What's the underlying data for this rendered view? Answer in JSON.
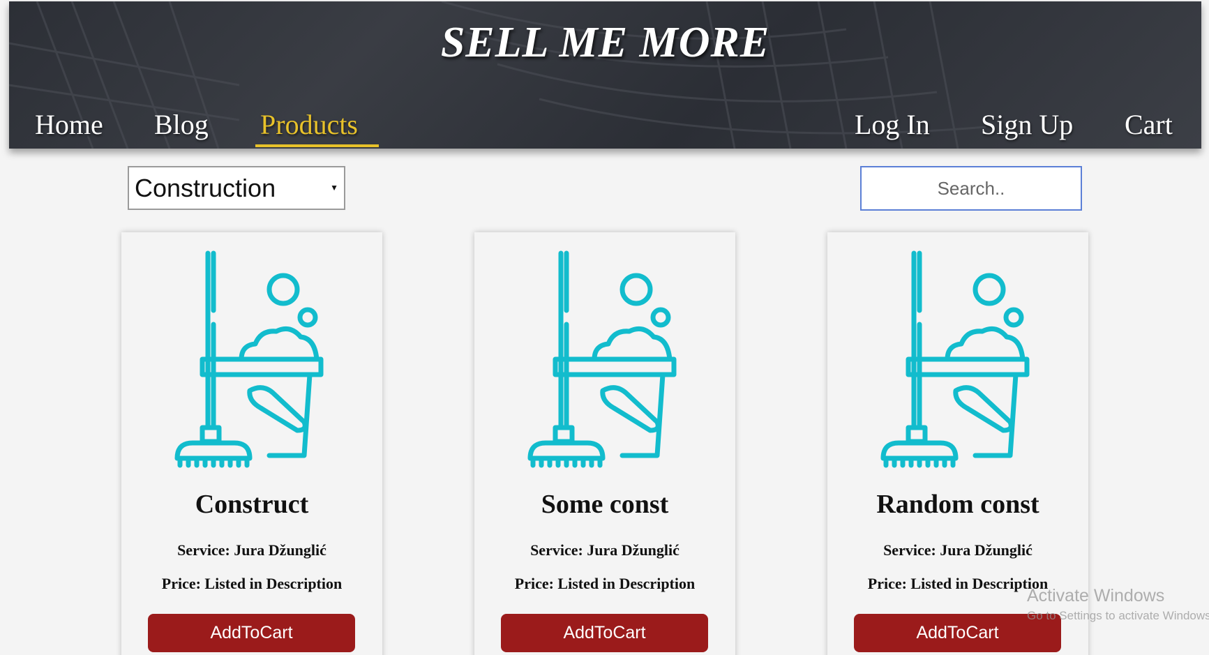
{
  "header": {
    "title": "SELL ME MORE",
    "nav_left": [
      {
        "label": "Home"
      },
      {
        "label": "Blog"
      },
      {
        "label": "Products",
        "active": true
      }
    ],
    "nav_right": [
      {
        "label": "Log In"
      },
      {
        "label": "Sign Up"
      },
      {
        "label": "Cart"
      }
    ]
  },
  "filters": {
    "category_selected": "Construction",
    "search_placeholder": "Search.."
  },
  "colors": {
    "accent_active": "#e8c22a",
    "button": "#9b1b1b",
    "icon": "#12bccd"
  },
  "products": [
    {
      "name": "Construct",
      "service": "Service: Jura Džunglić",
      "price": "Price: Listed in Description",
      "button": "AddToCart",
      "icon": "mop-bucket-icon"
    },
    {
      "name": "Some const",
      "service": "Service: Jura Džunglić",
      "price": "Price: Listed in Description",
      "button": "AddToCart",
      "icon": "mop-bucket-icon"
    },
    {
      "name": "Random const",
      "service": "Service: Jura Džunglić",
      "price": "Price: Listed in Description",
      "button": "AddToCart",
      "icon": "mop-bucket-icon"
    }
  ],
  "watermark": {
    "title": "Activate Windows",
    "subtitle": "Go to Settings to activate Windows."
  }
}
